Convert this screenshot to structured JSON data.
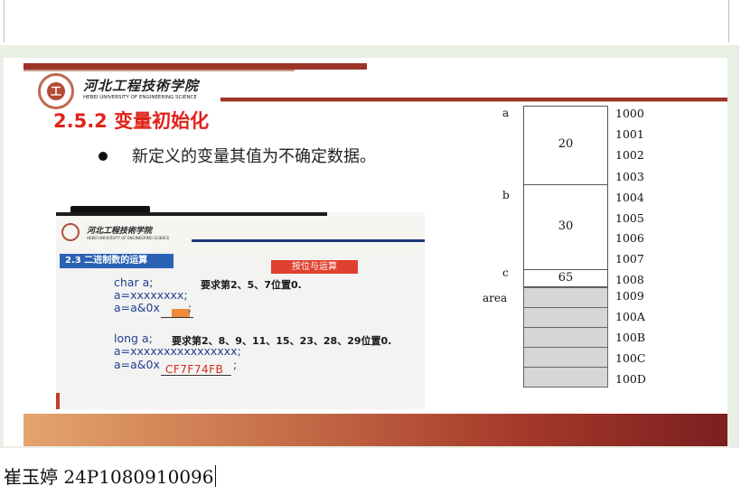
{
  "slide": {
    "school_cn": "河北工程技術学院",
    "school_en": "HEBEI UNIVERSITY OF ENGINEERING SCIENCE",
    "title": "2.5.2 变量初始化",
    "bullet": "新定义的变量其值为不确定数据。"
  },
  "photo": {
    "school_cn": "河北工程技術学院",
    "school_en": "HEBEI UNIVERSITY OF ENGINEERING SCIENCE",
    "section": "2.3  二进制数的运算",
    "badge": "按位与运算",
    "char_decl": "char  a;",
    "char_task": "要求第2、5、7位置0.",
    "char_assign": "a=xxxxxxxx;",
    "char_expr": "a=a&0x",
    "char_semicolon": ";",
    "long_decl": "long  a;",
    "long_task": "要求第2、8、9、11、15、23、28、29位置0.",
    "long_assign": "a=xxxxxxxxxxxxxxxx;",
    "long_expr": "a=a&0x",
    "long_hex": "CF7F74FB",
    "long_semicolon": ";"
  },
  "memory": {
    "vars": [
      "a",
      "b",
      "c",
      "area"
    ],
    "values": [
      "20",
      "30",
      "65"
    ],
    "addresses": [
      "1000",
      "1001",
      "1002",
      "1003",
      "1004",
      "1005",
      "1006",
      "1007",
      "1008",
      "1009",
      "100A",
      "100B",
      "100C",
      "100D"
    ]
  },
  "document": {
    "typed_text": "崔玉婷 24P1080910096"
  },
  "colors": {
    "title_red": "#e0231b",
    "head_rule": "#9c3428",
    "section_blue": "#2b62b5",
    "badge_red": "#e0402f",
    "footer_gradient": [
      "#e4a46e",
      "#7c1f20"
    ]
  }
}
